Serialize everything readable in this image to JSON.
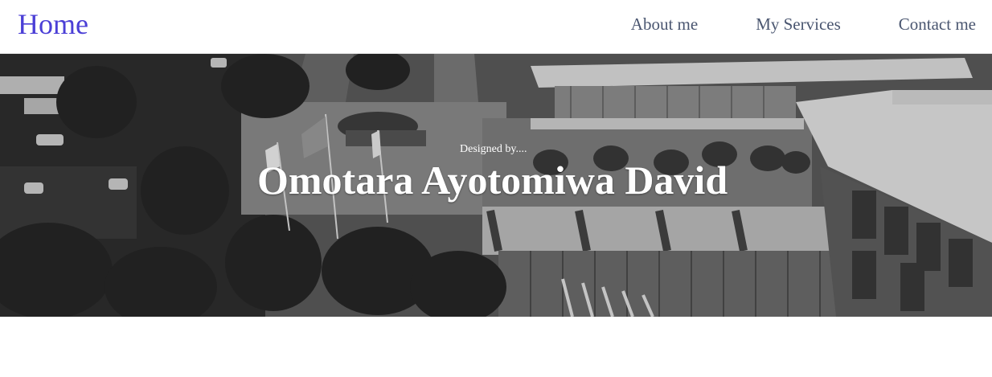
{
  "nav": {
    "brand": "Home",
    "links": [
      {
        "label": "About me"
      },
      {
        "label": "My Services"
      },
      {
        "label": "Contact me"
      }
    ]
  },
  "hero": {
    "subtitle": "Designed by....",
    "title": "Omotara Ayotomiwa David",
    "image": "grayscale-aerial-campus-photo"
  },
  "colors": {
    "brand": "#4b3fd6",
    "nav_text": "#4a5670",
    "hero_text": "#ffffff"
  }
}
